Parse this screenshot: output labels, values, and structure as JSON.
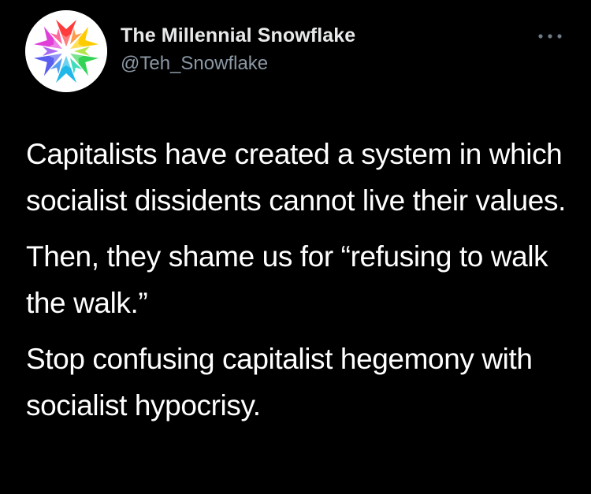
{
  "tweet": {
    "display_name": "The Millennial Snowflake",
    "handle": "@Teh_Snowflake",
    "avatar_icon": "rainbow-snowflake",
    "more_icon": "more-options-dots",
    "paragraphs": [
      "Capitalists have created a system in which socialist dissidents cannot live their values.",
      "Then, they shame us for “refusing to walk the walk.”",
      "Stop confusing capitalist hegemony with socialist hypocrisy."
    ]
  },
  "colors": {
    "background": "#000000",
    "name": "#e7e9ea",
    "handle": "#8b98a5",
    "text": "#ffffff"
  }
}
